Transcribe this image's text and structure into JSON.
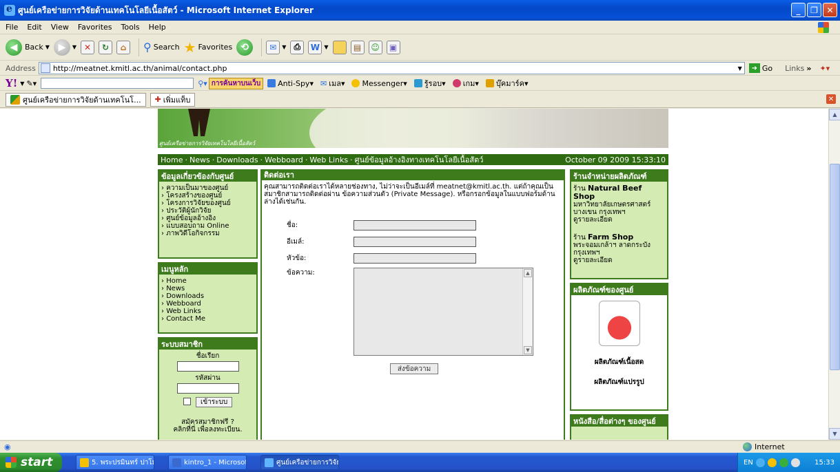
{
  "window": {
    "title": "ศูนย์เครือข่ายการวิจัยด้านเทคโนโลยีเนื้อสัตว์ - Microsoft Internet Explorer",
    "buttons": [
      "_",
      "❐",
      "✕"
    ]
  },
  "menu": [
    "File",
    "Edit",
    "View",
    "Favorites",
    "Tools",
    "Help"
  ],
  "toolbar": {
    "back": "Back",
    "search": "Search",
    "favorites": "Favorites"
  },
  "address": {
    "label": "Address",
    "url": "http://meatnet.kmitl.ac.th/animal/contact.php",
    "go": "Go",
    "links": "Links"
  },
  "yahoo": {
    "logo": "Y!",
    "search_button": "การค้นหาบนเว็บ",
    "items": [
      "Anti-Spy",
      "เมล",
      "Messenger",
      "รู้รอบ",
      "เกม",
      "บุ๊คมาร์ค"
    ]
  },
  "tabs": {
    "active": "ศูนย์เครือข่ายการวิจัยด้านเทคโนโ...",
    "new_tab": "เพิ่มแท็บ"
  },
  "site": {
    "brand": "ศูนย์เครือข่ายการวิจัยเทคโนโลยีเนื้อสัตว์",
    "nav": [
      "Home",
      "News",
      "Downloads",
      "Webboard",
      "Web Links",
      "ศูนย์ข้อมูลอ้างอิงทางเทคโนโลยีเนื้อสัตว์"
    ],
    "date": "October 09 2009 15:33:10",
    "about": {
      "title": "ข้อมูลเกี่ยวข้องกับศูนย์",
      "items": [
        "ความเป็นมาของศูนย์",
        "โครงสร้างของศูนย์",
        "โครงการวิจัยของศูนย์",
        "ประวัติผู้นักวิจัย",
        "ศูนย์ข้อมูลอ้างอิง",
        "แบบสอบถาม Online",
        "ภาพวิดีโอกิจกรรม"
      ]
    },
    "main_menu": {
      "title": "เมนูหลัก",
      "items": [
        "Home",
        "News",
        "Downloads",
        "Webboard",
        "Web Links",
        "Contact Me"
      ]
    },
    "members": {
      "title": "ระบบสมาชิก",
      "username_label": "ชื่อเรียก",
      "password_label": "รหัสผ่าน",
      "login_button": "เข้าระบบ",
      "register_line1": "สมัครสมาชิกฟรี ?",
      "register_line2": "คลิกที่นี่ เพื่อลงทะเบียน."
    },
    "contact": {
      "title": "ติดต่อเรา",
      "intro": "คุณสามารถติดต่อเราได้หลายช่องทาง, ไม่ว่าจะเป็นอีเมล์ที่ meatnet@kmitl.ac.th. แต่ถ้าคุณเป็นสมาชิกสามารถติดต่อผ่าน ข้อความส่วนตัว (Private Message). หรือกรอกข้อมูลในแบบฟอร์มด้านล่างได้เช่นกัน.",
      "name_label": "ชื่อ:",
      "email_label": "อีเมล์:",
      "subject_label": "หัวข้อ:",
      "message_label": "ข้อความ:",
      "send_button": "ส่งข้อความ"
    },
    "shops": {
      "title": "ร้านจำหน่ายผลิตภัณฑ์",
      "shop1_prefix": "ร้าน",
      "shop1_name": "Natural Beef Shop",
      "shop1_addr1": "มหาวิทยาลัยเกษตรศาสตร์",
      "shop1_addr2": "บางเขน กรุงเทพฯ",
      "shop1_more": "ดูรายละเอียด",
      "shop2_prefix": "ร้าน",
      "shop2_name": "Farm Shop",
      "shop2_addr1": "พระจอมเกล้าฯ ลาดกระบัง",
      "shop2_addr2": "กรุงเทพฯ",
      "shop2_more": "ดูรายละเอียด"
    },
    "products": {
      "title": "ผลิตภัณฑ์ของศูนย์",
      "fresh": "ผลิตภัณฑ์เนื้อสด",
      "processed": "ผลิตภัณฑ์แปรรูป"
    },
    "books": {
      "title": "หนังสือ/สื่อต่างๆ ของศูนย์"
    }
  },
  "status": {
    "zone": "Internet"
  },
  "taskbar": {
    "start": "start",
    "tasks": [
      "5. พระปรมินทร์ ปาโม...",
      "kintro_1 - Microsoft ...",
      "ศูนย์เครือข่ายการวิจัยด้..."
    ],
    "lang": "EN",
    "clock": "15:33"
  }
}
